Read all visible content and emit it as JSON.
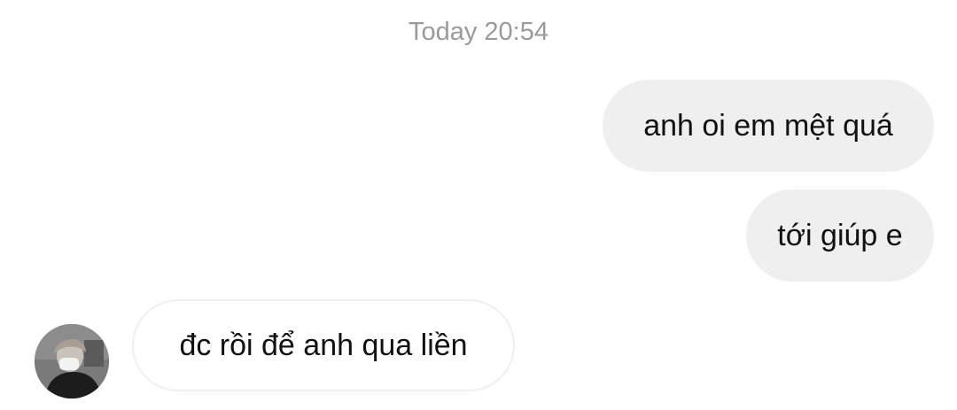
{
  "conversation": {
    "timestamp": "Today 20:54",
    "messages": [
      {
        "sender": "me",
        "text": "anh oi em mệt quá"
      },
      {
        "sender": "me",
        "text": "tới giúp e"
      },
      {
        "sender": "other",
        "text": "đc rồi để anh qua liền"
      }
    ]
  },
  "colors": {
    "outgoing_bubble": "#efefef",
    "incoming_border": "#efefef",
    "timestamp_text": "#9a9a9a",
    "message_text": "#111111"
  }
}
